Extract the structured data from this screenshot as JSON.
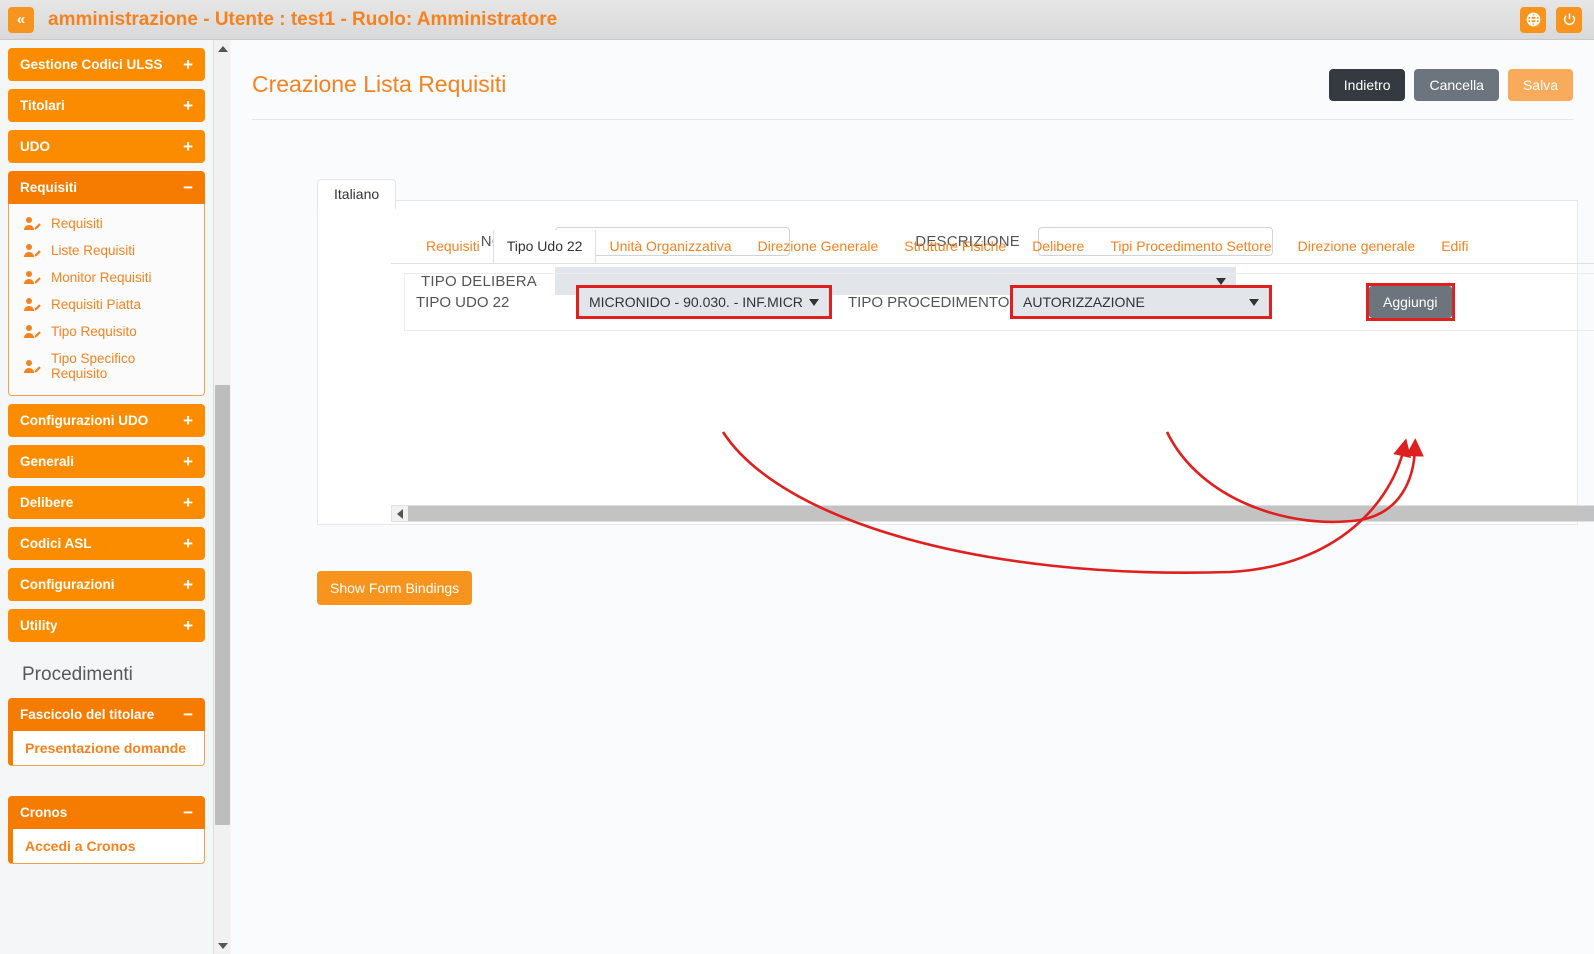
{
  "topbar": {
    "collapse_label": "«",
    "title": "amministrazione - Utente : test1 - Ruolo: Amministratore",
    "language_icon": "globe-icon",
    "logout_icon": "power-icon"
  },
  "sidebar": {
    "groups": [
      {
        "label": "Gestione Codici ULSS",
        "sign": "+",
        "expanded": false
      },
      {
        "label": "Titolari",
        "sign": "+",
        "expanded": false
      },
      {
        "label": "UDO",
        "sign": "+",
        "expanded": false
      },
      {
        "label": "Requisiti",
        "sign": "−",
        "expanded": true,
        "items": [
          {
            "label": "Requisiti",
            "icon": "user-edit-icon"
          },
          {
            "label": "Liste Requisiti",
            "icon": "user-edit-icon"
          },
          {
            "label": "Monitor Requisiti",
            "icon": "user-edit-icon"
          },
          {
            "label": "Requisiti Piatta",
            "icon": "user-edit-icon"
          },
          {
            "label": "Tipo Requisito",
            "icon": "user-edit-icon"
          },
          {
            "label": "Tipo Specifico Requisito",
            "icon": "user-edit-icon"
          }
        ]
      },
      {
        "label": "Configurazioni UDO",
        "sign": "+",
        "expanded": false
      },
      {
        "label": "Generali",
        "sign": "+",
        "expanded": false
      },
      {
        "label": "Delibere",
        "sign": "+",
        "expanded": false
      },
      {
        "label": "Codici ASL",
        "sign": "+",
        "expanded": false
      },
      {
        "label": "Configurazioni",
        "sign": "+",
        "expanded": false
      },
      {
        "label": "Utility",
        "sign": "+",
        "expanded": false
      }
    ],
    "section_title": "Procedimenti",
    "panels": [
      {
        "label": "Fascicolo del titolare",
        "sign": "−",
        "link": "Presentazione domande"
      },
      {
        "label": "Cronos",
        "sign": "−",
        "link": "Accedi a Cronos"
      }
    ]
  },
  "page": {
    "title": "Creazione Lista Requisiti",
    "actions": {
      "back": "Indietro",
      "cancel": "Cancella",
      "save": "Salva"
    }
  },
  "form": {
    "language_tab": "Italiano",
    "nome_label": "NOME *",
    "nome_value": "",
    "descrizione_label": "DESCRIZIONE",
    "descrizione_value": "",
    "tipo_delibera_label": "TIPO DELIBERA",
    "tipo_delibera_value": "",
    "caret_icon": "chevron-down-icon"
  },
  "inner_tabs": [
    {
      "label": "Requisiti",
      "active": false
    },
    {
      "label": "Tipo Udo 22",
      "active": true
    },
    {
      "label": "Unità Organizzativa",
      "active": false
    },
    {
      "label": "Direzione Generale",
      "active": false
    },
    {
      "label": "Strutture Fisiche",
      "active": false
    },
    {
      "label": "Delibere",
      "active": false
    },
    {
      "label": "Tipi Procedimento Settore",
      "active": false
    },
    {
      "label": "Direzione generale",
      "active": false
    },
    {
      "label": "Edifi",
      "active": false
    }
  ],
  "inner_form": {
    "tipo_udo_label": "TIPO UDO 22",
    "tipo_udo_value": "MICRONIDO - 90.030. - INF.MICR",
    "tipo_procedimento_label": "TIPO PROCEDIMENTO",
    "tipo_procedimento_value": "AUTORIZZAZIONE",
    "add_button": "Aggiungi"
  },
  "show_form_bindings_button": "Show Form Bindings",
  "colors": {
    "brand_orange": "#f5821f",
    "sidebar_orange": "#fb8c00",
    "highlight_red": "#e01f1f",
    "dark_button": "#343a40",
    "grey_button": "#6c757d",
    "save_orange": "#f9ab5c"
  }
}
